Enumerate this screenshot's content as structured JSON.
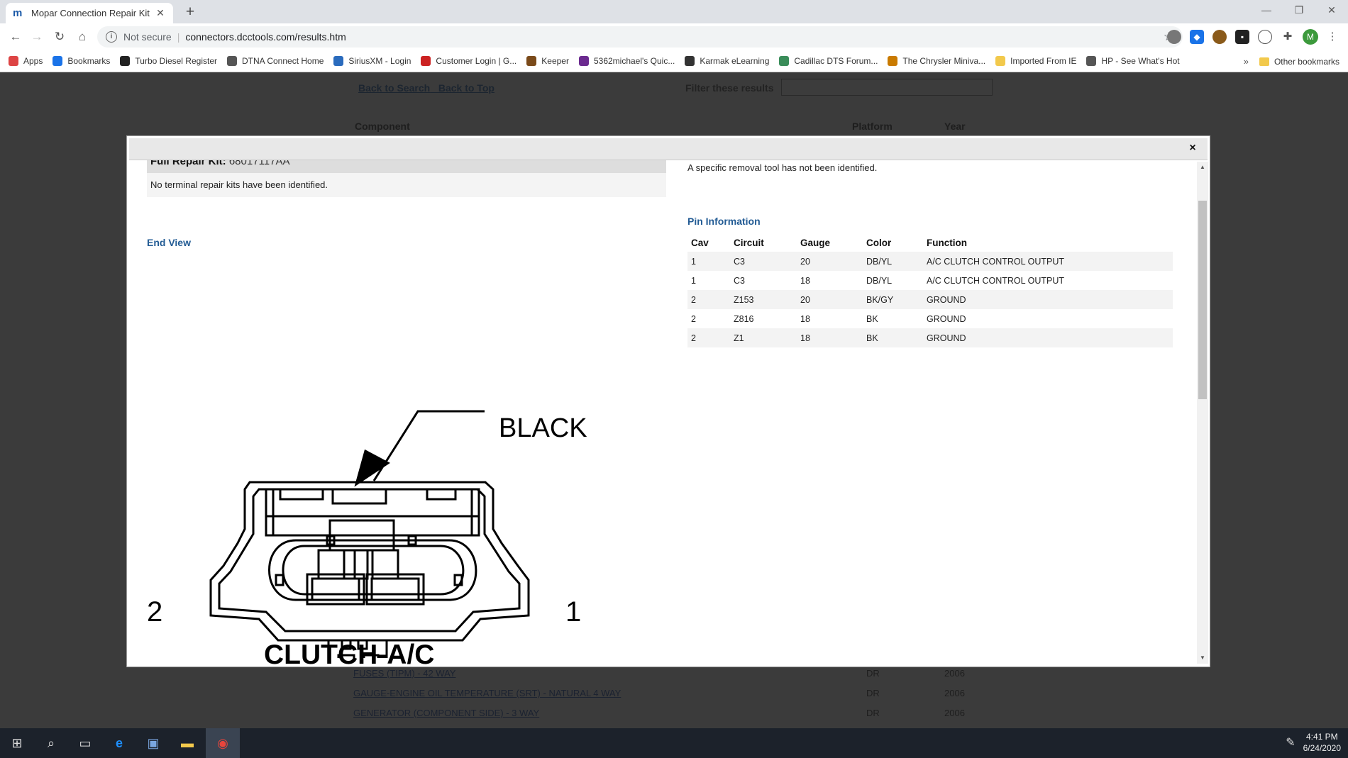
{
  "browser": {
    "tab_title": "Mopar Connection Repair Kit",
    "tab_favicon": "m",
    "security_label": "Not secure",
    "url": "connectors.dcctools.com/results.htm",
    "profile_initial": "M"
  },
  "bookmarks": [
    {
      "label": "Apps",
      "icon": "apps-grid-icon",
      "color": "#d44"
    },
    {
      "label": "Bookmarks",
      "icon": "star-icon",
      "color": "#1a73e8"
    },
    {
      "label": "Turbo Diesel Register",
      "icon": "tdr-icon",
      "color": "#222"
    },
    {
      "label": "DTNA Connect Home",
      "icon": "dtna-icon",
      "color": "#555"
    },
    {
      "label": "SiriusXM - Login",
      "icon": "siriusxm-icon",
      "color": "#2a6bbd"
    },
    {
      "label": "Customer Login | G...",
      "icon": "customer-icon",
      "color": "#c22"
    },
    {
      "label": "Keeper",
      "icon": "keeper-icon",
      "color": "#7a4a1a"
    },
    {
      "label": "5362michael's Quic...",
      "icon": "quic-icon",
      "color": "#6b2a8f"
    },
    {
      "label": "Karmak eLearning",
      "icon": "karmak-icon",
      "color": "#333"
    },
    {
      "label": "Cadillac DTS Forum...",
      "icon": "cadillac-icon",
      "color": "#3a8d5a"
    },
    {
      "label": "The Chrysler Miniva...",
      "icon": "chrysler-icon",
      "color": "#c97a00"
    },
    {
      "label": "Imported From IE",
      "icon": "folder-icon",
      "color": "#f2c94c"
    },
    {
      "label": "HP - See What's Hot",
      "icon": "globe-icon",
      "color": "#555"
    }
  ],
  "bookmarks_more": "»",
  "other_bookmarks": "Other bookmarks",
  "background_page": {
    "back_to_search": "Back to Search",
    "back_to_top": "Back to Top",
    "filter_label": "Filter these results",
    "col_component": "Component",
    "col_platform": "Platform",
    "col_year": "Year",
    "rows": [
      {
        "component": "FUSES (TIPM) - 42 WAY",
        "platform": "DR",
        "year": "2006"
      },
      {
        "component": "GAUGE-ENGINE OIL TEMPERATURE (SRT) - NATURAL 4 WAY",
        "platform": "DR",
        "year": "2006"
      },
      {
        "component": "GENERATOR (COMPONENT SIDE) - 3 WAY",
        "platform": "DR",
        "year": "2006"
      }
    ]
  },
  "modal": {
    "close_label": "×",
    "repair_kit_label": "Full Repair Kit:",
    "repair_kit_value": "68017117AA",
    "no_terminal_text": "No terminal repair kits have been identified.",
    "removal_text": "A specific removal tool has not been identified.",
    "end_view_label": "End View",
    "diagram": {
      "color_label": "BLACK",
      "pin_left": "2",
      "pin_right": "1",
      "connector_name": "CLUTCH-A/C"
    },
    "pin_info_label": "Pin Information",
    "pin_table": {
      "headers": [
        "Cav",
        "Circuit",
        "Gauge",
        "Color",
        "Function"
      ],
      "rows": [
        [
          "1",
          "C3",
          "20",
          "DB/YL",
          "A/C CLUTCH CONTROL OUTPUT"
        ],
        [
          "1",
          "C3",
          "18",
          "DB/YL",
          "A/C CLUTCH CONTROL OUTPUT"
        ],
        [
          "2",
          "Z153",
          "20",
          "BK/GY",
          "GROUND"
        ],
        [
          "2",
          "Z816",
          "18",
          "BK",
          "GROUND"
        ],
        [
          "2",
          "Z1",
          "18",
          "BK",
          "GROUND"
        ]
      ]
    }
  },
  "taskbar": {
    "time": "4:41 PM",
    "date": "6/24/2020"
  }
}
